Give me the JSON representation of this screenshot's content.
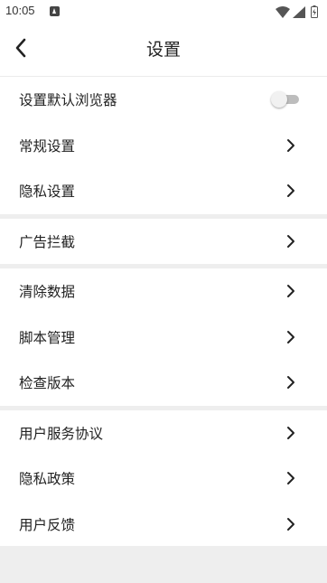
{
  "status_bar": {
    "time": "10:05",
    "icons": [
      "notification-icon",
      "wifi-icon",
      "signal-icon",
      "battery-icon"
    ]
  },
  "header": {
    "title": "设置",
    "back_icon": "chevron-left-icon"
  },
  "groups": [
    {
      "items": [
        {
          "label": "设置默认浏览器",
          "control": "toggle",
          "checked": false
        },
        {
          "label": "常规设置",
          "control": "chevron"
        },
        {
          "label": "隐私设置",
          "control": "chevron"
        }
      ]
    },
    {
      "items": [
        {
          "label": "广告拦截",
          "control": "chevron"
        }
      ]
    },
    {
      "items": [
        {
          "label": "清除数据",
          "control": "chevron"
        },
        {
          "label": "脚本管理",
          "control": "chevron"
        },
        {
          "label": "检查版本",
          "control": "chevron"
        }
      ]
    },
    {
      "items": [
        {
          "label": "用户服务协议",
          "control": "chevron"
        },
        {
          "label": "隐私政策",
          "control": "chevron"
        },
        {
          "label": "用户反馈",
          "control": "chevron"
        }
      ]
    }
  ],
  "colors": {
    "background": "#ffffff",
    "separator": "#eeeeee",
    "text": "#222222",
    "toggle_track_off": "#bdbdbd"
  }
}
